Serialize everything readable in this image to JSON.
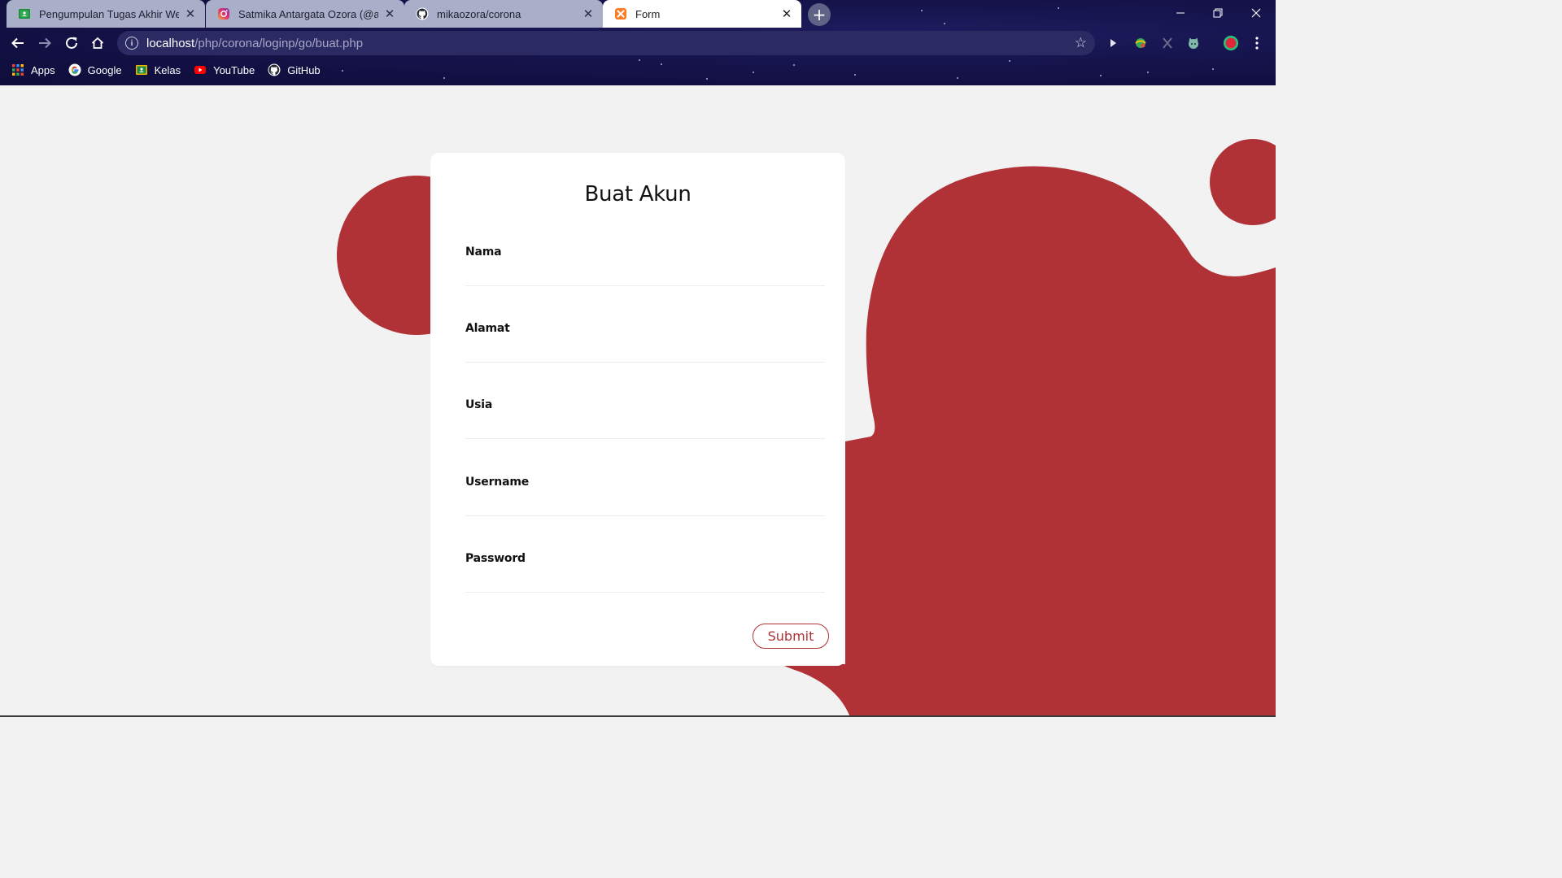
{
  "tabs": [
    {
      "title": "Pengumpulan Tugas Akhir Web",
      "icon": "classroom-icon"
    },
    {
      "title": "Satmika Antargata Ozora (@anta",
      "icon": "instagram-icon"
    },
    {
      "title": "mikaozora/corona",
      "icon": "github-icon"
    },
    {
      "title": "Form",
      "icon": "xampp-icon",
      "active": true
    }
  ],
  "omnibox": {
    "host": "localhost",
    "path": "/php/corona/loginp/go/buat.php"
  },
  "bookmarks": [
    {
      "label": "Apps",
      "icon": "apps-grid-icon"
    },
    {
      "label": "Google",
      "icon": "google-icon"
    },
    {
      "label": "Kelas",
      "icon": "classroom-icon"
    },
    {
      "label": "YouTube",
      "icon": "youtube-icon"
    },
    {
      "label": "GitHub",
      "icon": "github-icon"
    }
  ],
  "form": {
    "title": "Buat Akun",
    "fields": [
      {
        "label": "Nama",
        "value": ""
      },
      {
        "label": "Alamat",
        "value": ""
      },
      {
        "label": "Usia",
        "value": ""
      },
      {
        "label": "Username",
        "value": ""
      },
      {
        "label": "Password",
        "value": ""
      }
    ],
    "submit_label": "Submit"
  },
  "colors": {
    "accent": "#b03237",
    "page_bg": "#f2f2f2",
    "chrome_bg": "#15134a"
  }
}
